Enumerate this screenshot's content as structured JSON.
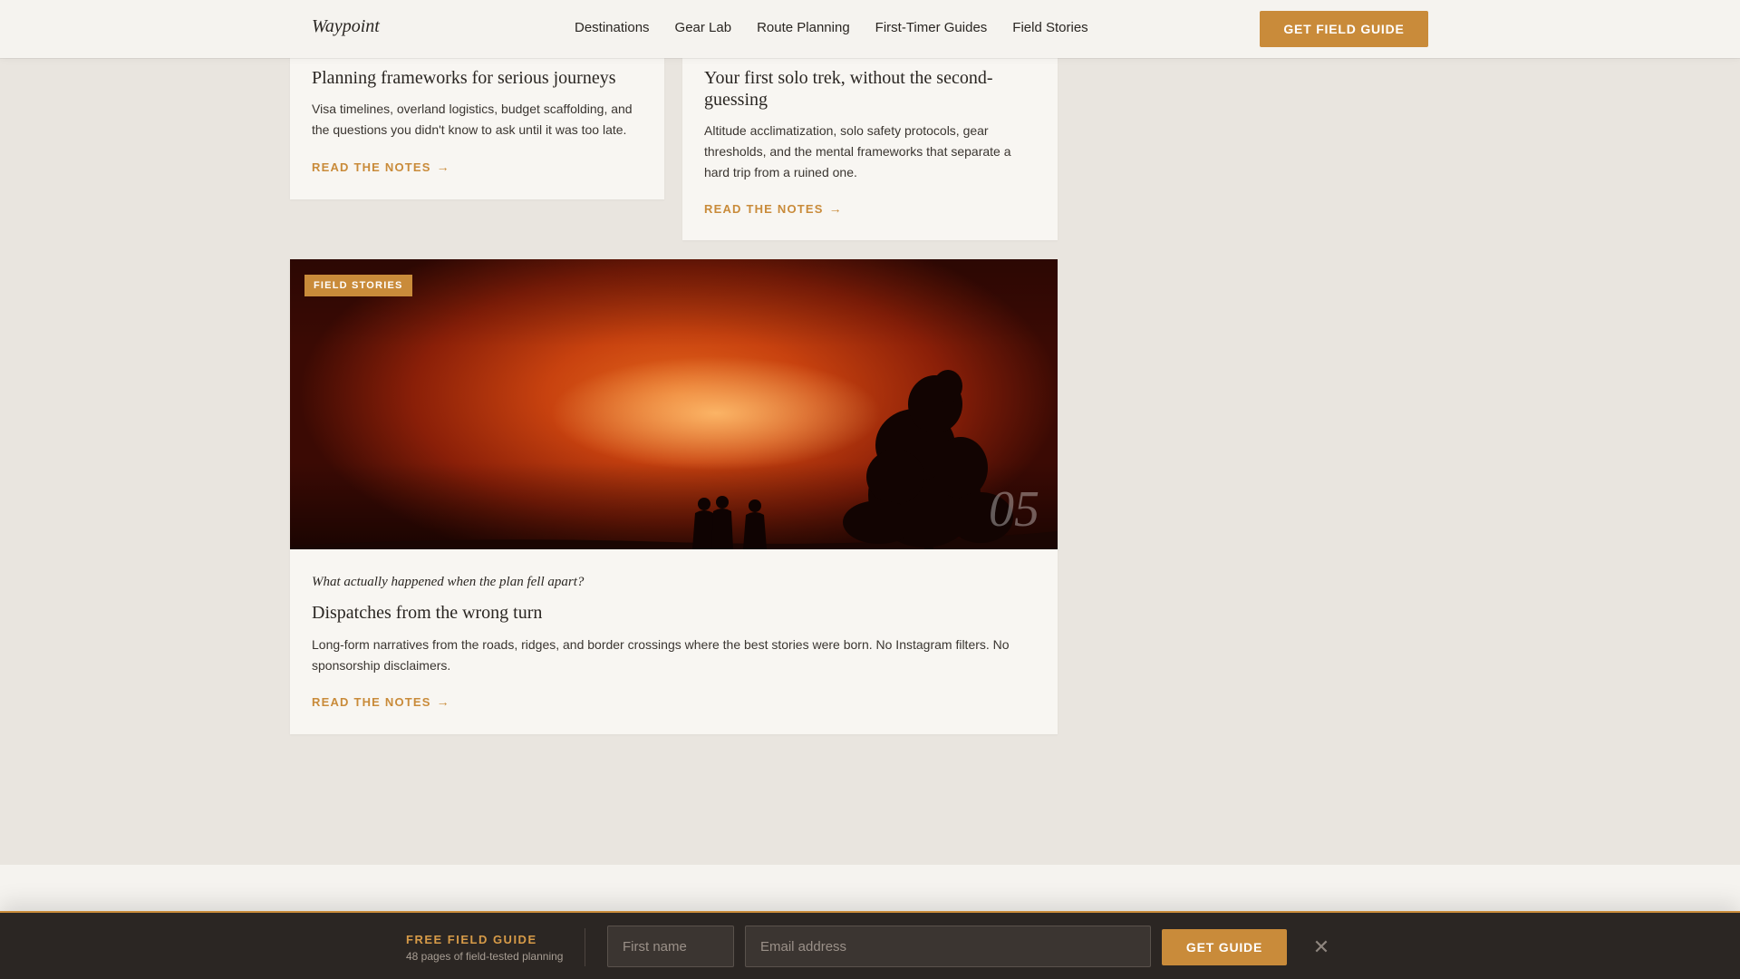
{
  "header": {
    "logo": "Waypoint",
    "nav": [
      "Destinations",
      "Gear Lab",
      "Route Planning",
      "First-Timer Guides",
      "Field Stories"
    ],
    "cta": "GET FIELD GUIDE"
  },
  "cards": [
    {
      "title": "Planning frameworks for serious journeys",
      "description": "Visa timelines, overland logistics, budget scaffolding, and the questions you didn't know to ask until it was too late.",
      "link": "READ THE NOTES"
    },
    {
      "title": "Your first solo trek, without the second-guessing",
      "description": "Altitude acclimatization, solo safety protocols, gear thresholds, and the mental frameworks that separate a hard trip from a ruined one.",
      "link": "READ THE NOTES"
    }
  ],
  "feature": {
    "badge": "FIELD STORIES",
    "number": "05",
    "kicker": "What actually happened when the plan fell apart?",
    "title": "Dispatches from the wrong turn",
    "description": "Long-form narratives from the roads, ridges, and border crossings where the best stories were born. No Instagram filters. No sponsorship disclaimers.",
    "link": "READ THE NOTES"
  },
  "sticky": {
    "title": "FREE FIELD GUIDE",
    "subtitle": "48 pages of field-tested planning",
    "first_name_placeholder": "First name",
    "email_placeholder": "Email address",
    "cta": "GET GUIDE",
    "close_icon": "close-icon"
  },
  "colors": {
    "accent": "#c98b3a",
    "background": "#e9e5df",
    "card": "#f8f6f2",
    "sticky_bar": "#2b2623"
  }
}
